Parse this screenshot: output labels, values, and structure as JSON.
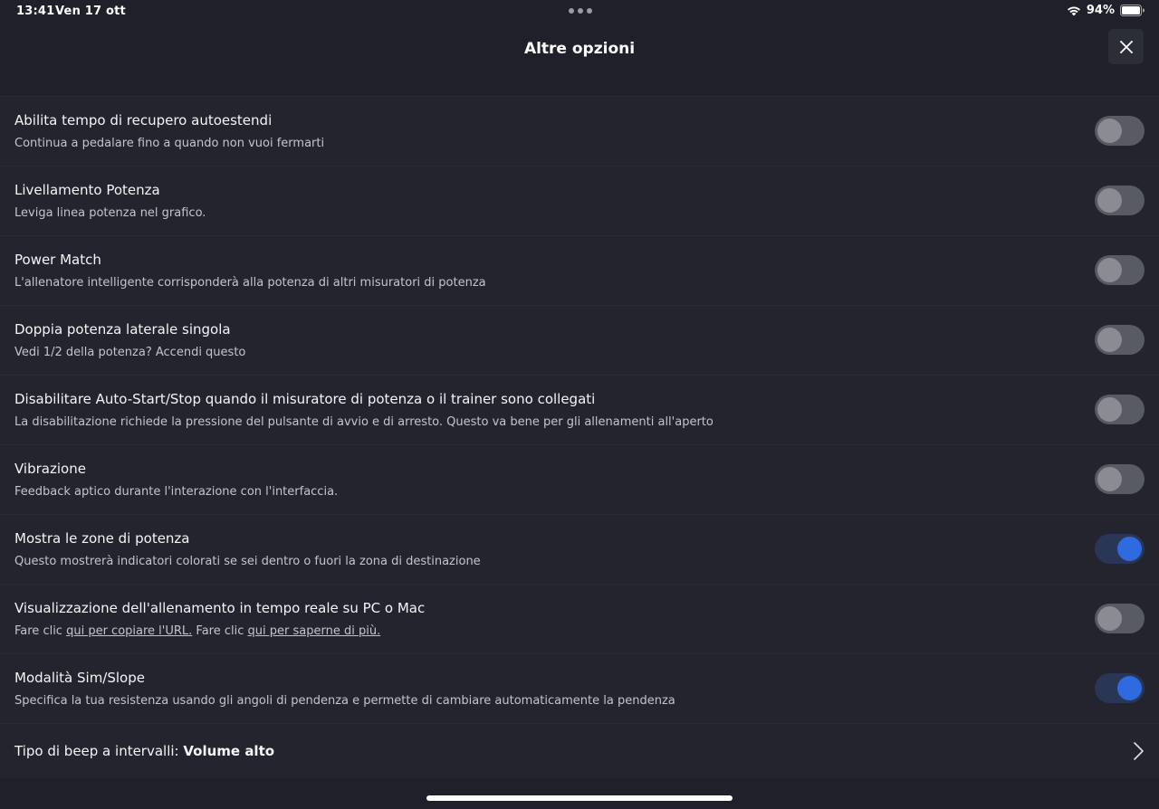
{
  "status_bar": {
    "time": "13:41",
    "date": "Ven 17 ott",
    "battery": "94%"
  },
  "header": {
    "title": "Altre opzioni"
  },
  "settings": [
    {
      "title": "Abilita tempo di recupero autoestendi",
      "description": "Continua a pedalare fino a quando non vuoi fermarti",
      "enabled": false
    },
    {
      "title": "Livellamento Potenza",
      "description": "Leviga linea potenza nel grafico.",
      "enabled": false
    },
    {
      "title": "Power Match",
      "description": "L'allenatore intelligente corrisponderà alla potenza di altri misuratori di potenza",
      "enabled": false
    },
    {
      "title": "Doppia potenza laterale singola",
      "description": "Vedi 1/2 della potenza? Accendi questo",
      "enabled": false
    },
    {
      "title": "Disabilitare Auto-Start/Stop quando il misuratore di potenza o il trainer sono collegati",
      "description": "La disabilitazione richiede la pressione del pulsante di avvio e di arresto. Questo va bene per gli allenamenti all'aperto",
      "enabled": false
    },
    {
      "title": "Vibrazione",
      "description": "Feedback aptico durante l'interazione con l'interfaccia.",
      "enabled": false
    },
    {
      "title": "Mostra le zone di potenza",
      "description": "Questo mostrerà indicatori colorati se sei dentro o fuori la zona di destinazione",
      "enabled": true
    }
  ],
  "live_view": {
    "title": "Visualizzazione dell'allenamento in tempo reale su PC o Mac",
    "prefix_1": "Fare clic ",
    "link_1": "qui per copiare l'URL.",
    "prefix_2": " Fare clic ",
    "link_2": "qui per saperne di più.",
    "enabled": false
  },
  "sim_slope": {
    "title": "Modalità Sim/Slope",
    "description": "Specifica la tua resistenza usando gli angoli di pendenza e permette di cambiare automaticamente la pendenza",
    "enabled": true
  },
  "beep_type": {
    "label": "Tipo di beep a intervalli: ",
    "value": "Volume alto"
  },
  "colors": {
    "background": "#1f2029",
    "row": "#23242e",
    "toggle_on": "#2f6ae0",
    "toggle_off": "#585a64"
  }
}
